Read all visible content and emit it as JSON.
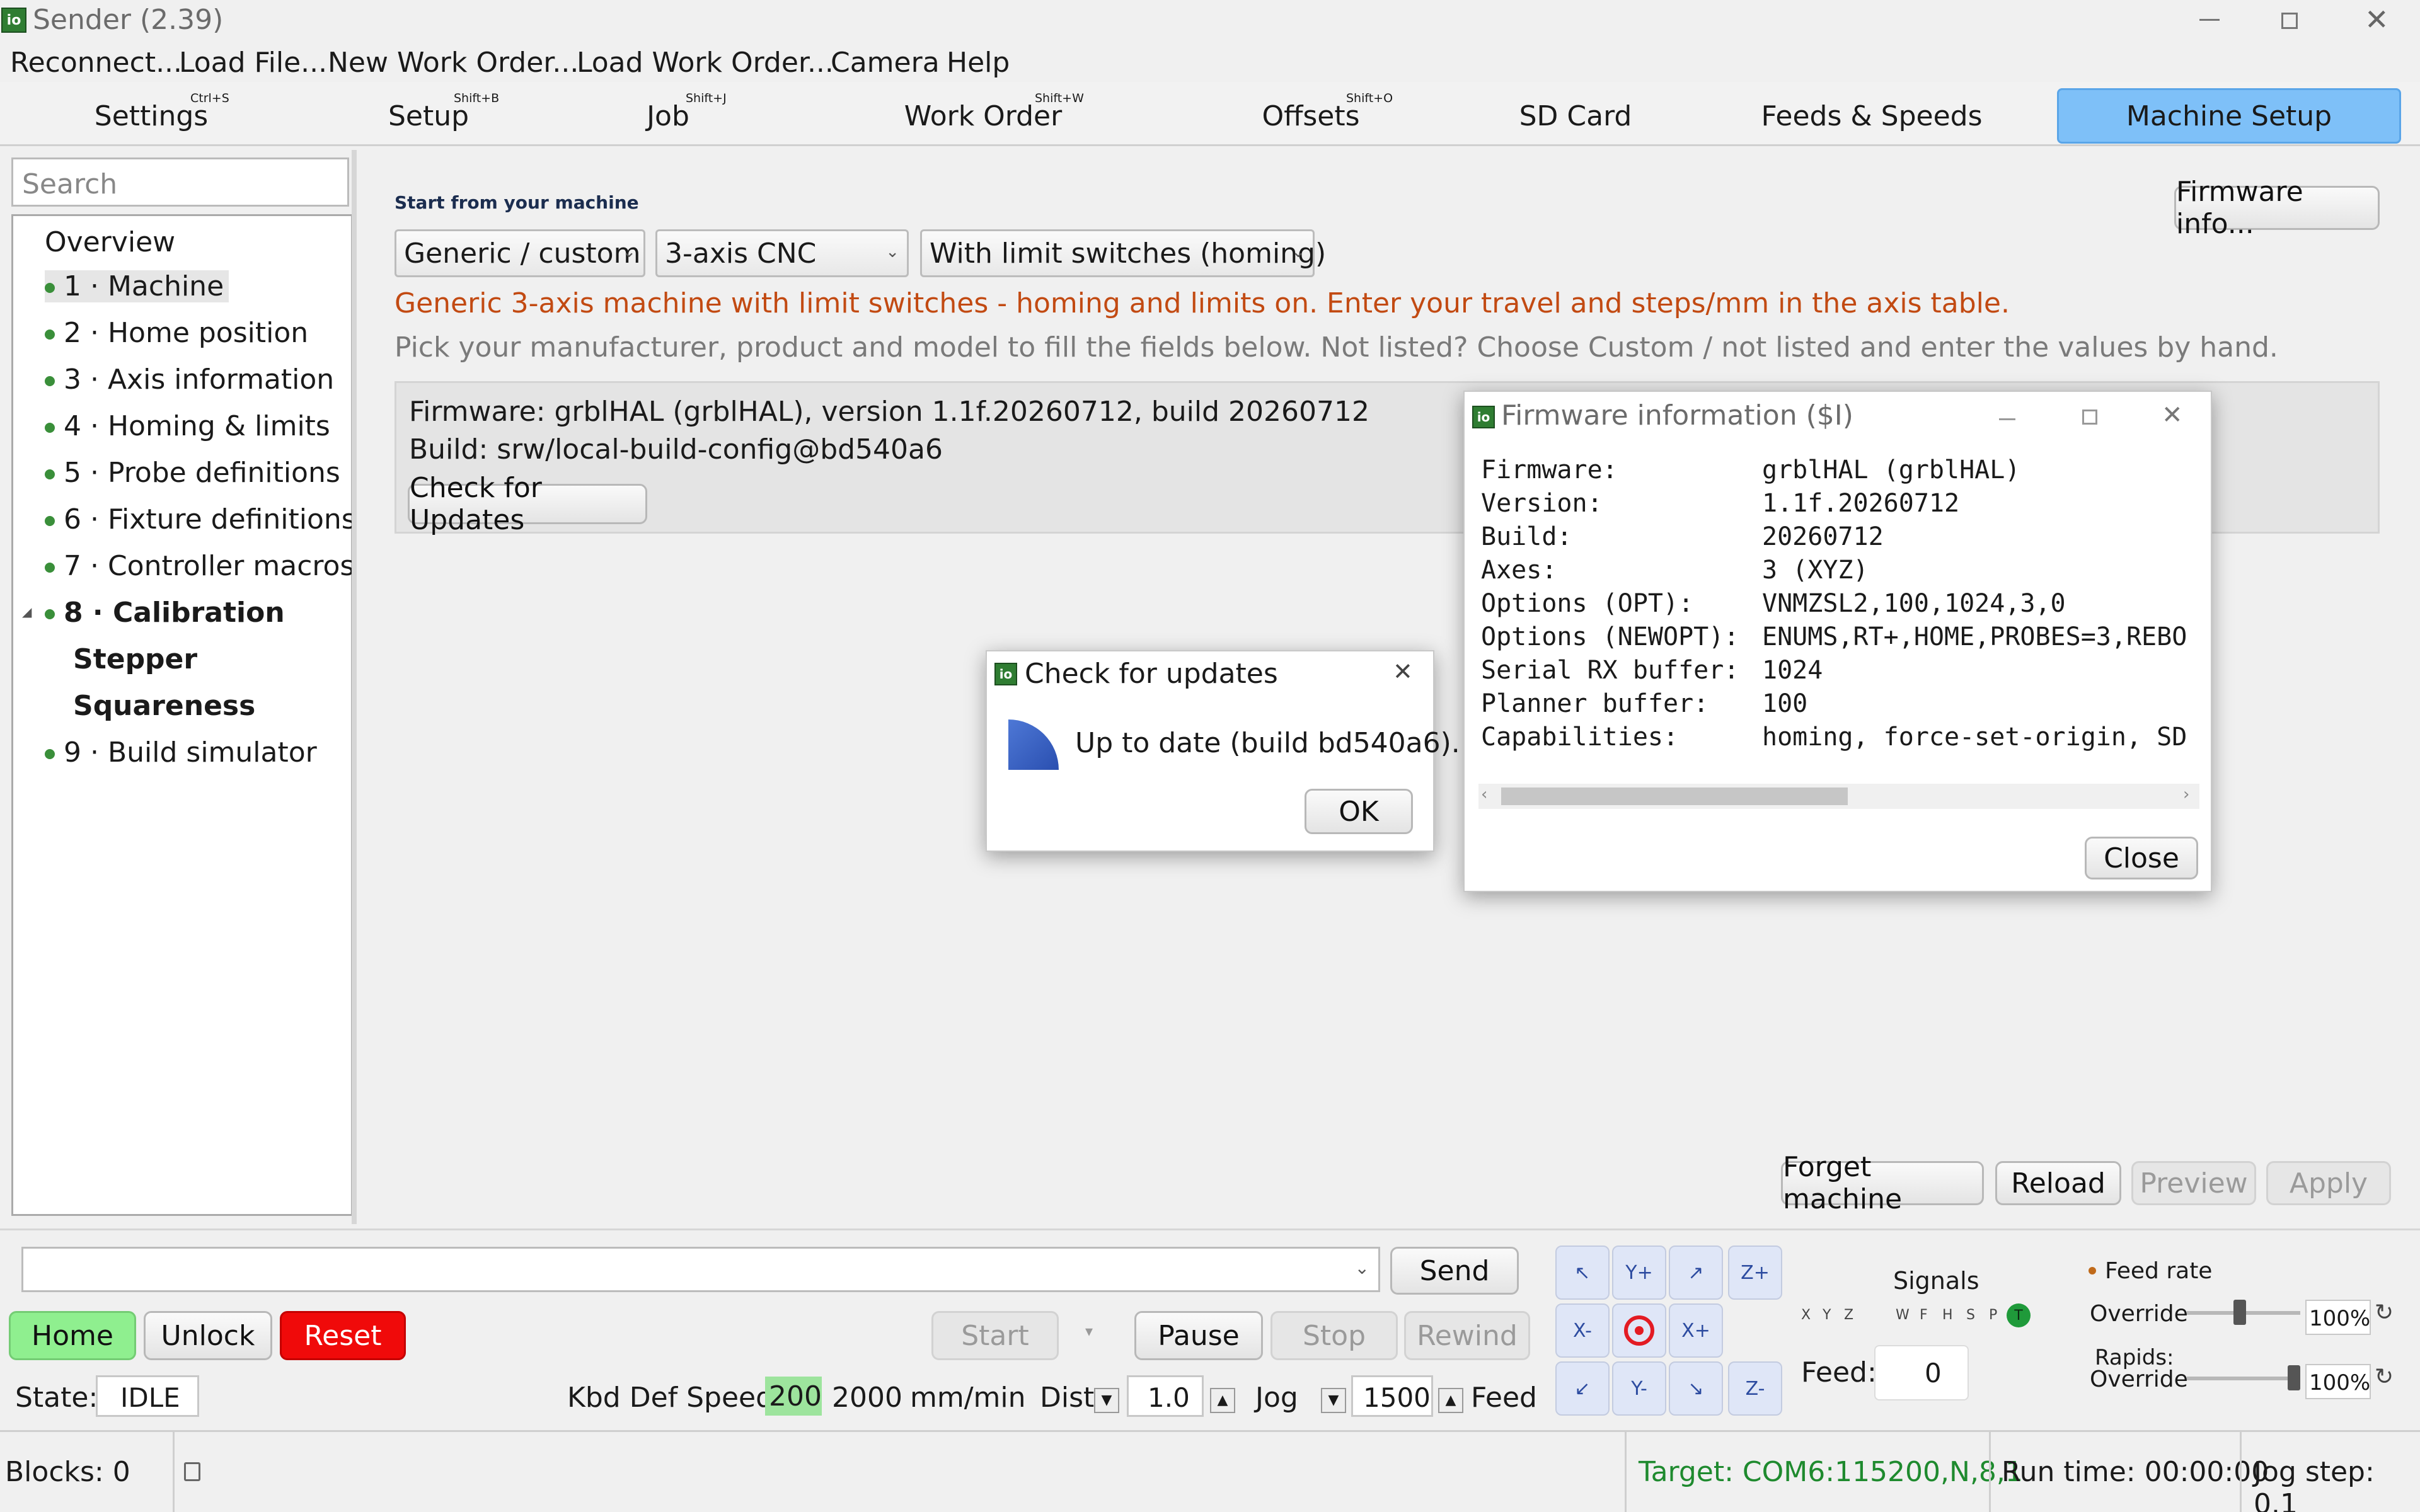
{
  "window": {
    "title": "Sender (2.39)"
  },
  "menu": [
    "Reconnect...",
    "Load File...",
    "New Work Order...",
    "Load Work Order...",
    "Camera",
    "Help"
  ],
  "tabs": [
    {
      "label": "Settings",
      "shortcut": "Ctrl+S"
    },
    {
      "label": "Setup",
      "shortcut": "Shift+B"
    },
    {
      "label": "Job",
      "shortcut": "Shift+J"
    },
    {
      "label": "Work Order",
      "shortcut": "Shift+W"
    },
    {
      "label": "Offsets",
      "shortcut": "Shift+O"
    },
    {
      "label": "SD Card",
      "shortcut": ""
    },
    {
      "label": "Feeds & Speeds",
      "shortcut": ""
    },
    {
      "label": "Machine Setup",
      "shortcut": "",
      "active": true
    }
  ],
  "sidebar": {
    "search_placeholder": "Search",
    "items": [
      {
        "label": "Overview"
      },
      {
        "label": "1 · Machine"
      },
      {
        "label": "2 · Home position"
      },
      {
        "label": "3 · Axis information"
      },
      {
        "label": "4 · Homing & limits"
      },
      {
        "label": "5 · Probe definitions"
      },
      {
        "label": "6 · Fixture definitions"
      },
      {
        "label": "7 · Controller macros"
      },
      {
        "label": "8 · Calibration"
      },
      {
        "label": "Stepper"
      },
      {
        "label": "Squareness"
      },
      {
        "label": "9 · Build simulator"
      }
    ]
  },
  "main": {
    "section_label": "Start from your machine",
    "firmware_info_button": "Firmware info...",
    "manufacturer": "Generic / custom",
    "machine_type": "3-axis CNC",
    "limit_option": "With limit switches (homing)",
    "description": "Generic 3-axis machine with limit switches - homing and limits on. Enter your travel and steps/mm in the axis table.",
    "hint": "Pick your manufacturer, product and model to fill the fields below. Not listed? Choose Custom / not listed and enter the values by hand.",
    "firmware_line": "Firmware: grblHAL (grblHAL), version 1.1f.20260712, build 20260712",
    "build_line": "Build: srw/local-build-config@bd540a6",
    "check_updates": "Check for Updates",
    "forget_machine": "Forget machine",
    "reload": "Reload",
    "preview": "Preview",
    "apply": "Apply",
    "accent_color": "#c24a12"
  },
  "fw_dialog": {
    "title": "Firmware information ($I)",
    "rows": [
      {
        "key": "Firmware:",
        "value": "grblHAL (grblHAL)"
      },
      {
        "key": "Version:",
        "value": "1.1f.20260712"
      },
      {
        "key": "Build:",
        "value": "20260712"
      },
      {
        "key": "Axes:",
        "value": "3 (XYZ)"
      },
      {
        "key": "Options (OPT):",
        "value": "VNMZSL2,100,1024,3,0"
      },
      {
        "key": "Options (NEWOPT):",
        "value": "ENUMS,RT+,HOME,PROBES=3,REBO"
      },
      {
        "key": "Serial RX buffer:",
        "value": "1024"
      },
      {
        "key": "Planner buffer:",
        "value": "100"
      },
      {
        "key": "Capabilities:",
        "value": "homing, force-set-origin, SD"
      }
    ],
    "close": "Close"
  },
  "update_dialog": {
    "title": "Check for updates",
    "message": "Up to date (build bd540a6).",
    "ok": "OK"
  },
  "bottom": {
    "send": "Send",
    "home": "Home",
    "unlock": "Unlock",
    "reset": "Reset",
    "start": "Start",
    "pause": "Pause",
    "stop": "Stop",
    "rewind": "Rewind",
    "state_label": "State:",
    "state_value": "IDLE",
    "kbd_label": "Kbd Def Speed:",
    "kbd_speed": "200",
    "kbd_speed2": "2000",
    "kbd_unit": "mm/min",
    "dist_label": "Dist",
    "dist_value": "1.0",
    "jog_label": "Jog",
    "jog_value": "1500",
    "feed_label": "Feed",
    "jog_buttons": {
      "yplus": "Y+",
      "yminus": "Y-",
      "xplus": "X+",
      "xminus": "X-",
      "zplus": "Z+",
      "zminus": "Z-"
    },
    "signals_title": "Signals",
    "signal_letters": [
      "X",
      "Y",
      "Z",
      "W",
      "F",
      "H",
      "S",
      "P",
      "T"
    ],
    "feed_label2": "Feed:",
    "feed_value": "0",
    "feed_rate_title": "Feed rate",
    "override_label": "Override",
    "feed_override": "100%",
    "rapids_label": "Rapids:",
    "rapids_override_label": "Override",
    "rapids_override": "100%"
  },
  "statusbar": {
    "blocks": "Blocks: 0",
    "target": "Target: COM6:115200,N,8,1",
    "runtime": "Run time: 00:00:00",
    "jogstep": "Jog step: 0.1"
  }
}
